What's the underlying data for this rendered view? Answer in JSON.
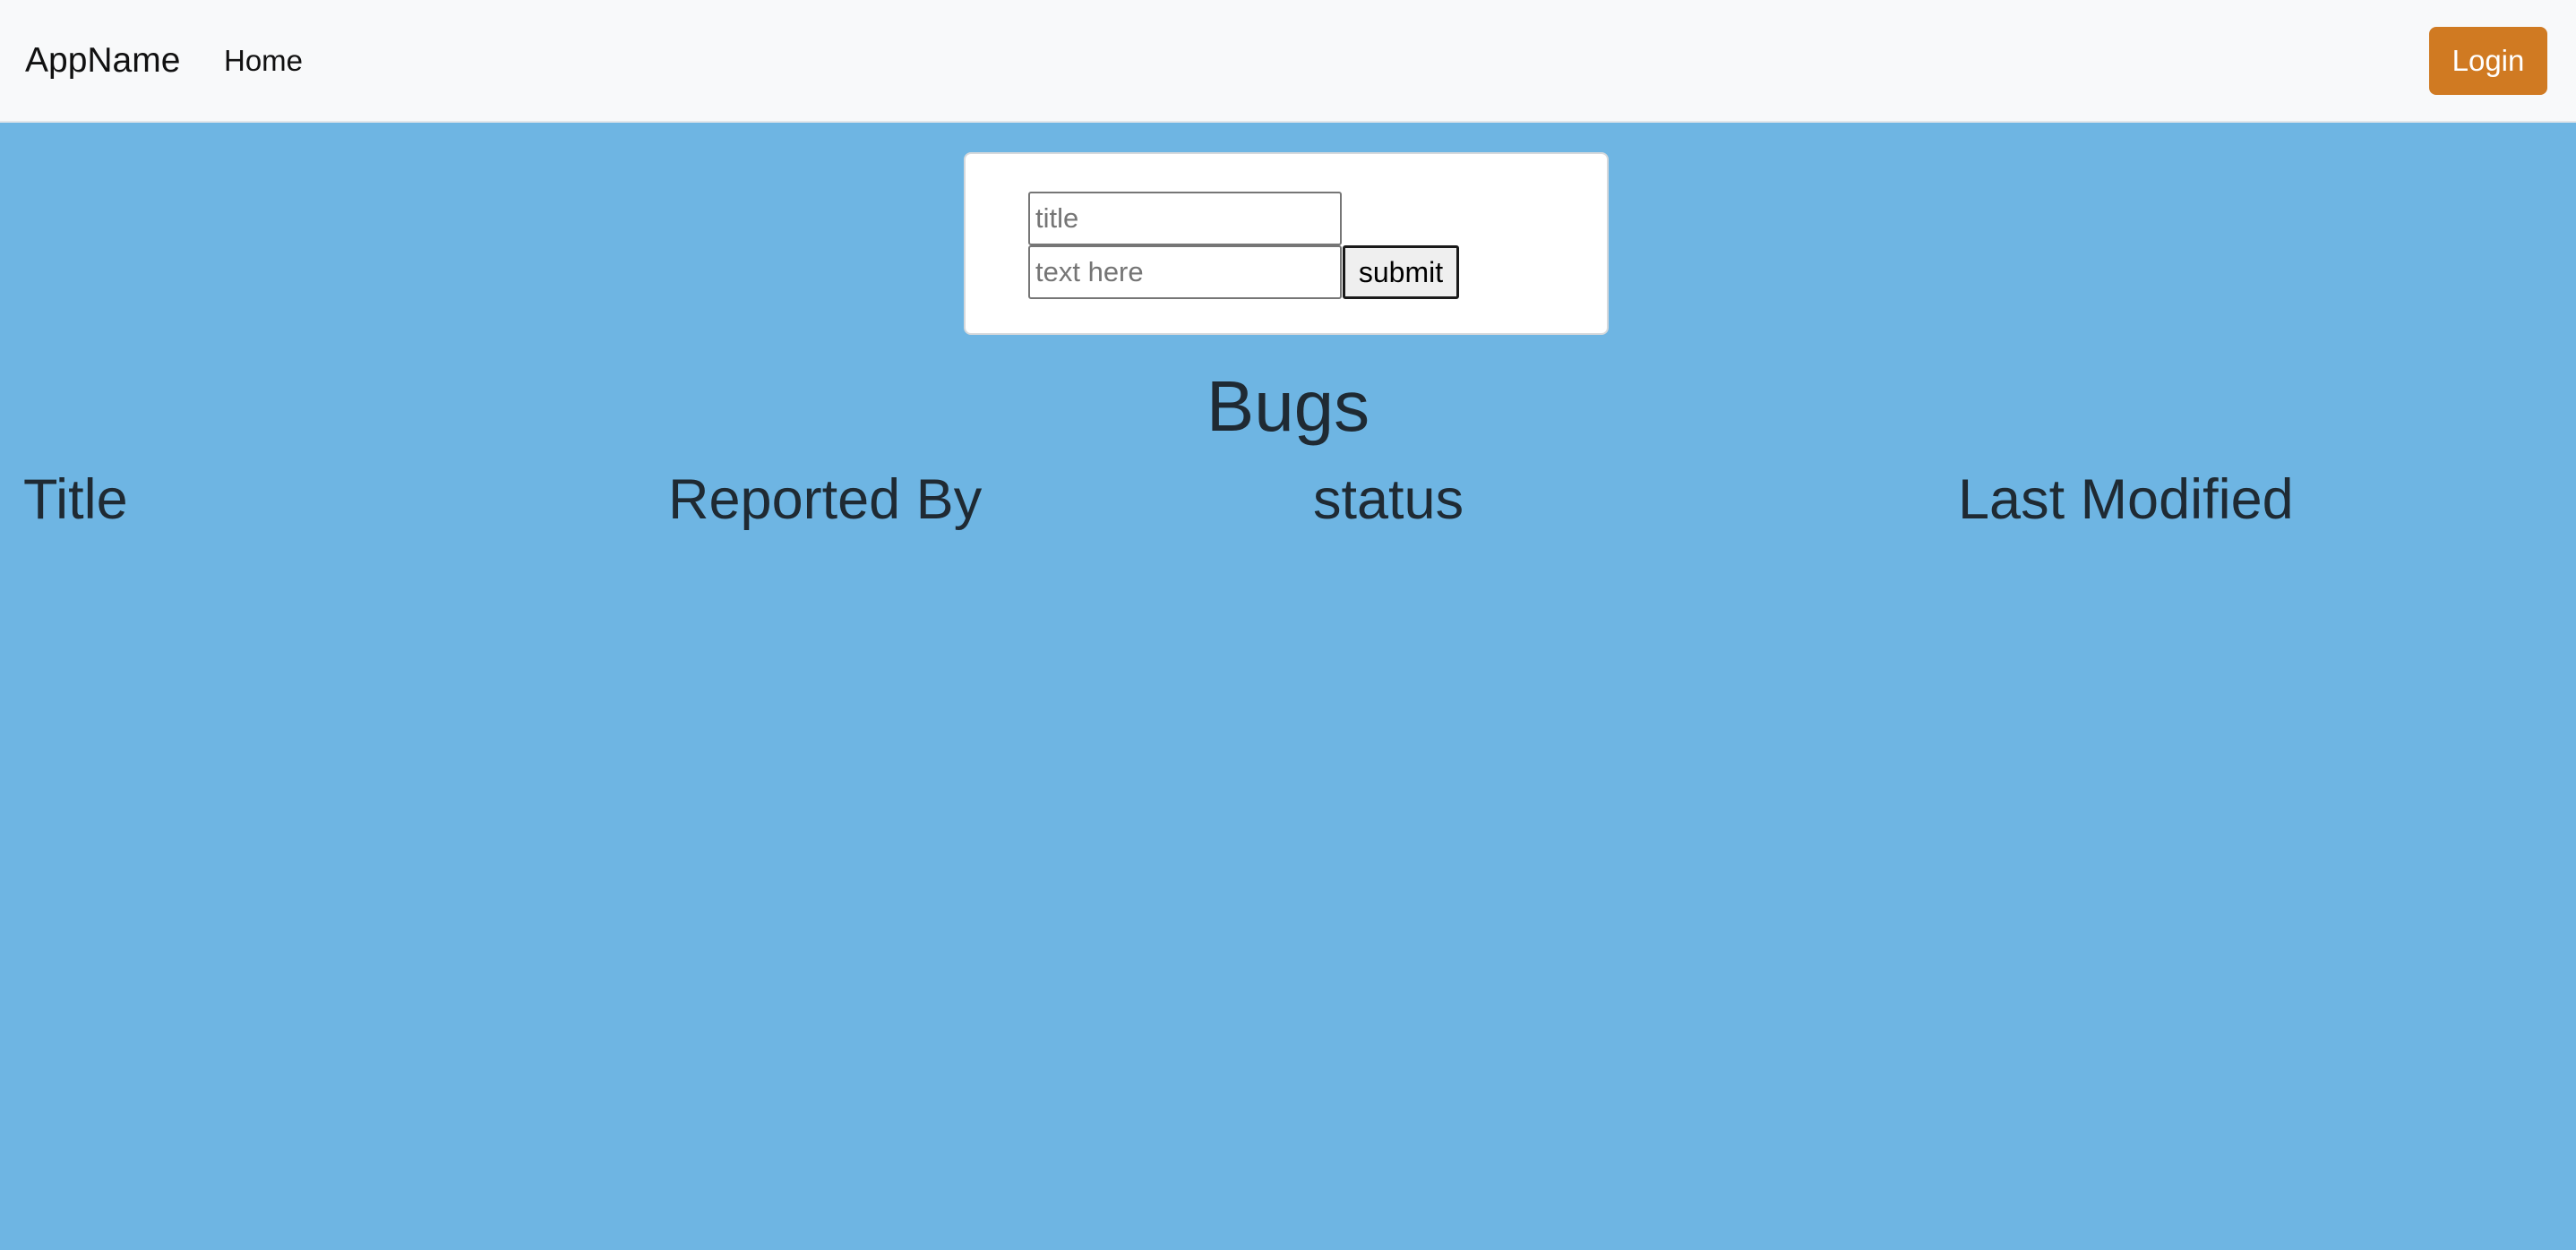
{
  "navbar": {
    "brand": "AppName",
    "links": [
      {
        "label": "Home"
      }
    ],
    "login_label": "Login"
  },
  "colors": {
    "background": "#6eb5e3",
    "navbar": "#f8f9fa",
    "login_button": "#d07a22",
    "card": "#ffffff",
    "heading_text": "#1f2a33"
  },
  "form": {
    "title_value": "",
    "title_placeholder": "title",
    "text_value": "",
    "text_placeholder": "text here",
    "submit_label": "submit"
  },
  "page": {
    "title": "Bugs"
  },
  "table": {
    "headers": [
      "Title",
      "Reported By",
      "status",
      "Last Modified"
    ],
    "rows": []
  }
}
